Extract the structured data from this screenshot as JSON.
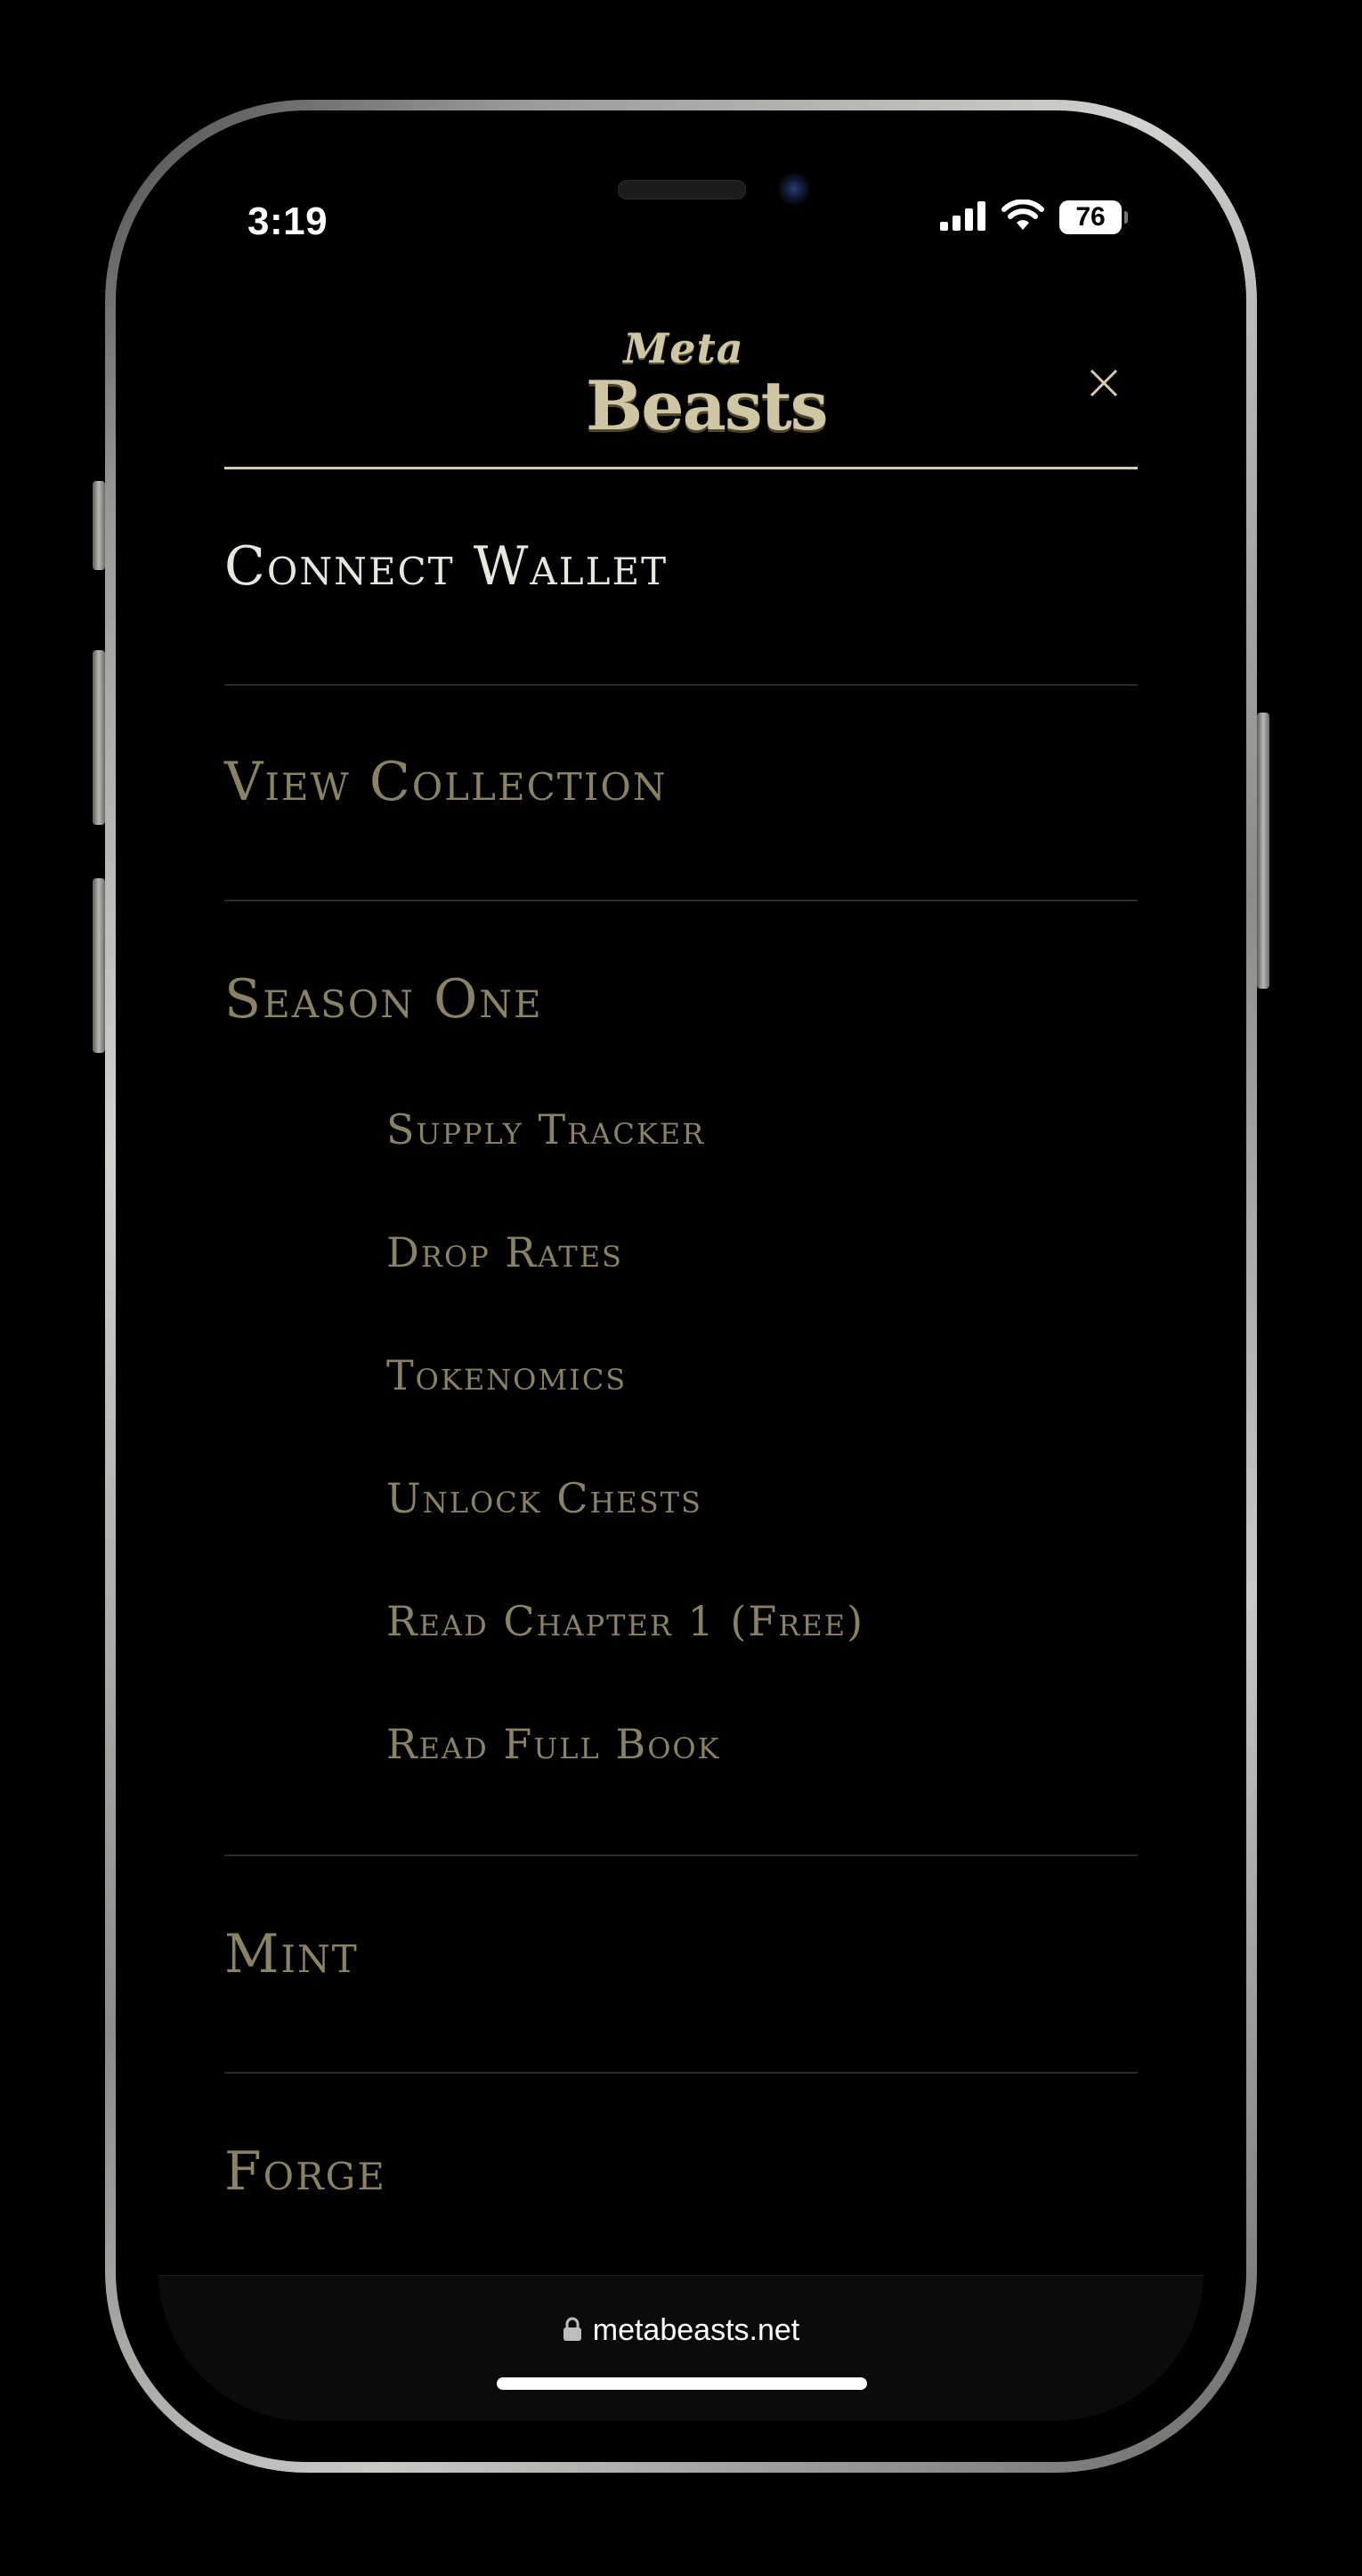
{
  "status_bar": {
    "time": "3:19",
    "battery": "76"
  },
  "header": {
    "logo_top": "Meta",
    "logo_bottom": "Beasts"
  },
  "menu": {
    "connect_wallet": "Connect Wallet",
    "view_collection": "View Collection",
    "season_one": "Season One",
    "season_one_items": [
      "Supply Tracker",
      "Drop Rates",
      "Tokenomics",
      "Unlock Chests",
      "Read Chapter 1 (Free)",
      "Read Full Book"
    ],
    "mint": "Mint",
    "forge": "Forge"
  },
  "browser": {
    "url": "metabeasts.net"
  },
  "colors": {
    "accent_gold": "#cfc6a4",
    "muted_gold": "#8a8263",
    "active_text": "#e9e6dc",
    "rule": "#d8ccaa"
  }
}
